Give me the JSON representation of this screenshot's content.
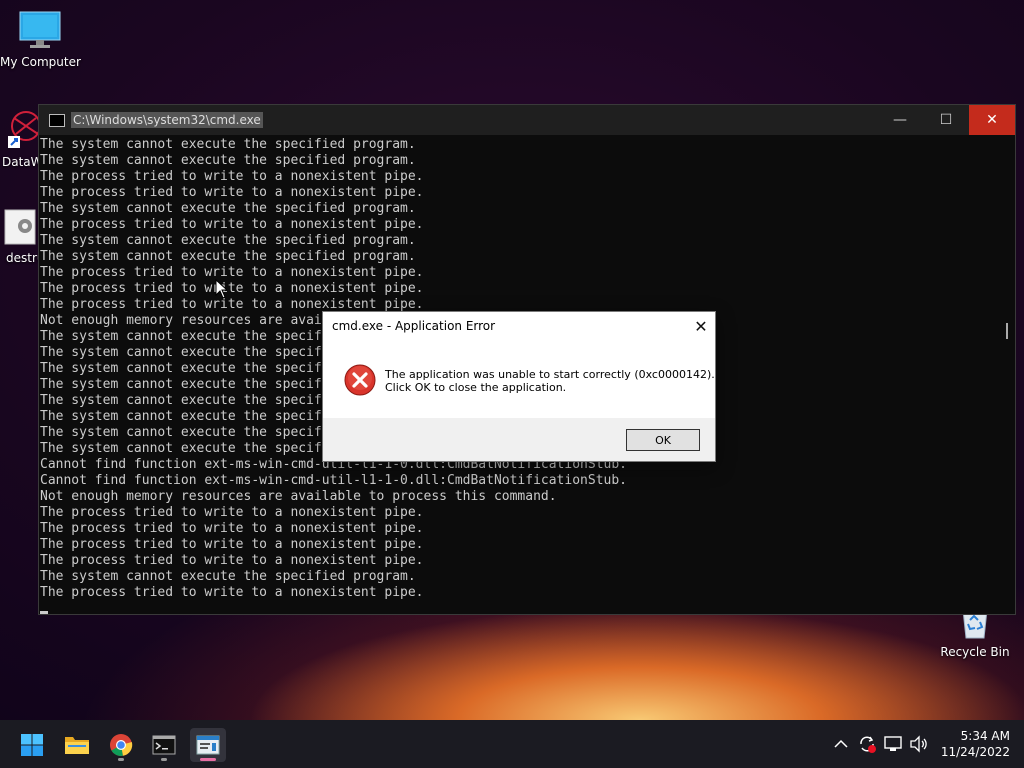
{
  "desktop": {
    "icons": [
      {
        "label": "My Computer"
      },
      {
        "label": "DataW"
      },
      {
        "label": "destru"
      },
      {
        "label": "Recycle Bin"
      }
    ]
  },
  "cmd": {
    "title": "C:\\Windows\\system32\\cmd.exe",
    "lines": [
      "The system cannot execute the specified program.",
      "The system cannot execute the specified program.",
      "The process tried to write to a nonexistent pipe.",
      "The process tried to write to a nonexistent pipe.",
      "The system cannot execute the specified program.",
      "The process tried to write to a nonexistent pipe.",
      "The system cannot execute the specified program.",
      "The system cannot execute the specified program.",
      "The process tried to write to a nonexistent pipe.",
      "The process tried to write to a nonexistent pipe.",
      "The process tried to write to a nonexistent pipe.",
      "Not enough memory resources are available to process this command.",
      "The system cannot execute the specified program.",
      "The system cannot execute the specified program.",
      "The system cannot execute the specified program.",
      "The system cannot execute the specified program.",
      "The system cannot execute the specified program.",
      "The system cannot execute the specified program.",
      "The system cannot execute the specified program.",
      "The system cannot execute the specified program.",
      "Cannot find function ext-ms-win-cmd-util-l1-1-0.dll:CmdBatNotificationStub.",
      "Cannot find function ext-ms-win-cmd-util-l1-1-0.dll:CmdBatNotificationStub.",
      "Not enough memory resources are available to process this command.",
      "The process tried to write to a nonexistent pipe.",
      "The process tried to write to a nonexistent pipe.",
      "The process tried to write to a nonexistent pipe.",
      "The process tried to write to a nonexistent pipe.",
      "The system cannot execute the specified program.",
      "The process tried to write to a nonexistent pipe."
    ]
  },
  "dialog": {
    "title": "cmd.exe - Application Error",
    "message_line1": "The application was unable to start correctly (0xc0000142).",
    "message_line2": "Click OK to close the application.",
    "ok_label": "OK",
    "icon": "error-icon"
  },
  "taskbar": {
    "items": [
      {
        "name": "start-button",
        "icon": "windows-logo-icon"
      },
      {
        "name": "file-explorer",
        "icon": "folder-icon"
      },
      {
        "name": "chrome",
        "icon": "chrome-icon"
      },
      {
        "name": "terminal",
        "icon": "terminal-icon"
      },
      {
        "name": "cmd-app",
        "icon": "app-window-icon",
        "active": true
      }
    ],
    "time": "5:34 AM",
    "date": "11/24/2022"
  },
  "colors": {
    "close_red": "#c42b1c",
    "error_red": "#d9342b",
    "active_indicator": "#e86fa4"
  }
}
